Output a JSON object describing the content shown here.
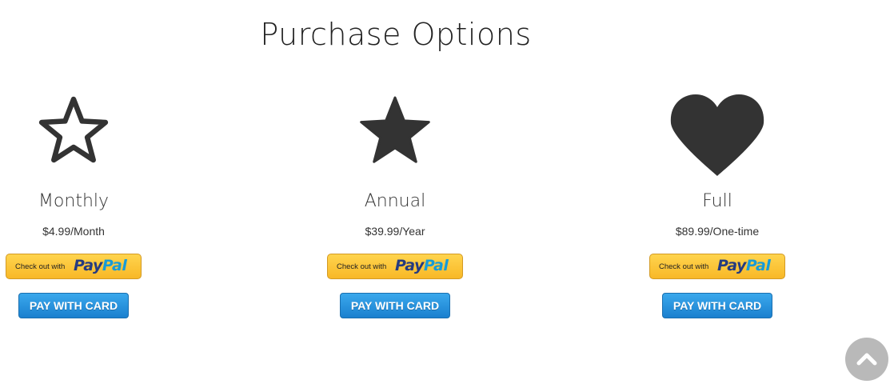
{
  "page": {
    "title": "Purchase Options"
  },
  "plans": [
    {
      "icon": "star-outline-icon",
      "name": "Monthly",
      "price": "$4.99/Month",
      "paypal_checkout": "Check out with",
      "paypal_brand_pay": "Pay",
      "paypal_brand_pal": "Pal",
      "card_button": "PAY WITH CARD"
    },
    {
      "icon": "star-filled-icon",
      "name": "Annual",
      "price": "$39.99/Year",
      "paypal_checkout": "Check out with",
      "paypal_brand_pay": "Pay",
      "paypal_brand_pal": "Pal",
      "card_button": "PAY WITH CARD"
    },
    {
      "icon": "heart-icon",
      "name": "Full",
      "price": "$89.99/One-time",
      "paypal_checkout": "Check out with",
      "paypal_brand_pay": "Pay",
      "paypal_brand_pal": "Pal",
      "card_button": "PAY WITH CARD"
    }
  ],
  "scroll_top": {
    "icon": "chevron-up-icon"
  },
  "colors": {
    "icon": "#333333",
    "paypal_yellow": "#f8b827",
    "paypal_dark_blue": "#253b80",
    "paypal_light_blue": "#179bd7",
    "card_button_blue": "#1a80cf",
    "scroll_top_gray": "#b9b9b9"
  }
}
